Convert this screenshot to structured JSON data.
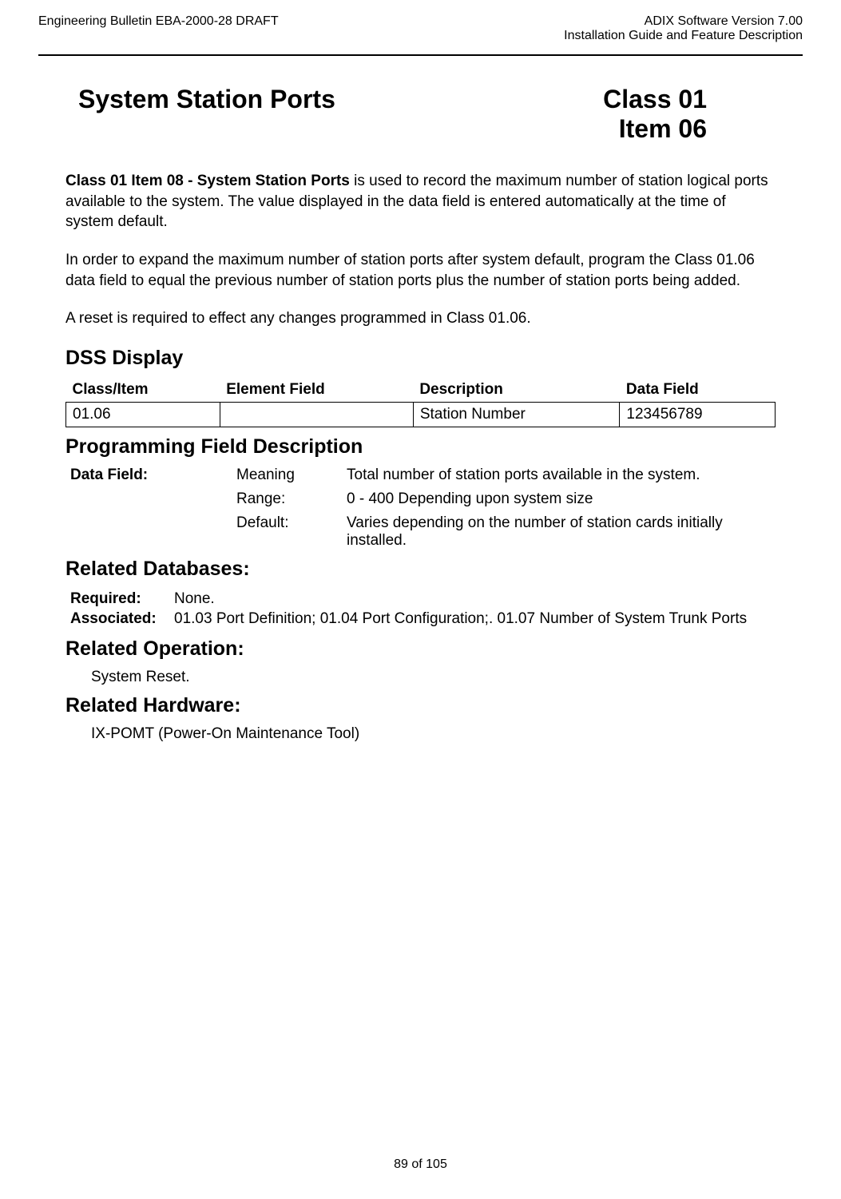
{
  "header": {
    "left": "Engineering Bulletin EBA-2000-28 DRAFT",
    "right1": "ADIX Software Version 7.00",
    "right2": "Installation Guide and Feature Description"
  },
  "title": {
    "left": "System Station Ports",
    "right1": "Class 01",
    "right2": "Item 06"
  },
  "paragraphs": {
    "p1_bold": "Class 01 Item 08 - System Station Ports",
    "p1_rest": " is used to record the maximum number of station logical ports available to the system. The value displayed in the data field is entered automatically at the time of system default.",
    "p2": "In order to expand the maximum number of station ports after system default, program the Class 01.06 data field to equal the previous number of station ports plus the number of station ports being added.",
    "p3": "A reset is required to effect any changes programmed in Class 01.06."
  },
  "sections": {
    "dss": "DSS Display",
    "pfd": "Programming Field Description",
    "rd": "Related Databases:",
    "ro": "Related Operation:",
    "rh": "Related Hardware:"
  },
  "dss_table": {
    "headers": [
      "Class/Item",
      "Element Field",
      "Description",
      "Data Field"
    ],
    "row": [
      "01.06",
      "",
      "Station Number",
      "123456789"
    ]
  },
  "pf": {
    "label": "Data Field:",
    "rows": [
      {
        "k": "Meaning",
        "v": "Total number of station ports available in the system."
      },
      {
        "k": "Range:",
        "v": "0 - 400 Depending upon system size"
      },
      {
        "k": "Default:",
        "v": "Varies depending on the number of station cards initially installed."
      }
    ]
  },
  "rd": {
    "required_label": "Required:",
    "required_val": "None.",
    "associated_label": "Associated:",
    "associated_val": "01.03 Port Definition; 01.04 Port Configuration;. 01.07 Number of System Trunk Ports"
  },
  "ro_text": "System Reset.",
  "rh_text": "IX-POMT (Power-On Maintenance Tool)",
  "footer": "89 of 105"
}
